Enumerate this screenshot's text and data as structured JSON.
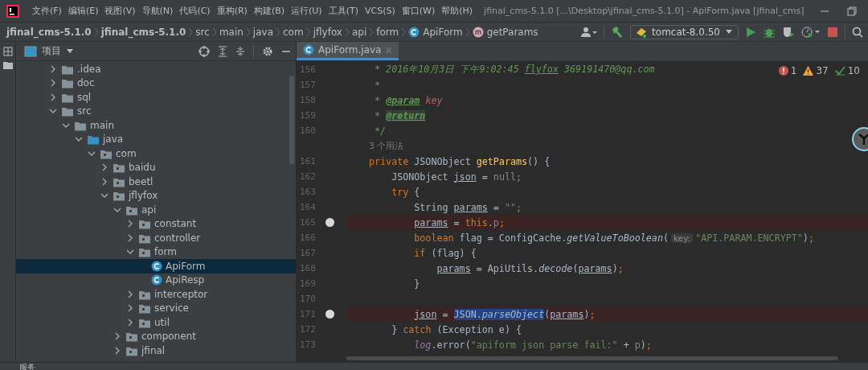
{
  "title_bar": {
    "menus": [
      "文件(F)",
      "编辑(E)",
      "视图(V)",
      "导航(N)",
      "代码(C)",
      "重构(R)",
      "构建(B)",
      "运行(U)",
      "工具(T)",
      "VCS(S)",
      "窗口(W)",
      "帮助(H)"
    ],
    "title": "jfinal_cms-5.1.0 [...\\Desktop\\jfinal_cms-5.1.0] - ApiForm.java [jfinal_cms]"
  },
  "breadcrumbs": [
    {
      "label": "jfinal_cms-5.1.0",
      "kind": "module"
    },
    {
      "label": "jfinal_cms-5.1.0",
      "kind": "module"
    },
    {
      "label": "src",
      "kind": "folder"
    },
    {
      "label": "main",
      "kind": "folder"
    },
    {
      "label": "java",
      "kind": "folder"
    },
    {
      "label": "com",
      "kind": "folder"
    },
    {
      "label": "jflyfox",
      "kind": "folder"
    },
    {
      "label": "api",
      "kind": "folder"
    },
    {
      "label": "form",
      "kind": "folder"
    },
    {
      "label": "ApiForm",
      "kind": "class"
    },
    {
      "label": "getParams",
      "kind": "method"
    }
  ],
  "toolbar": {
    "run_config": "tomcat-8.0.50"
  },
  "project_panel": {
    "title": "项目",
    "tree": [
      {
        "label": ".idea",
        "kind": "folder",
        "expanded": false,
        "selected": false
      },
      {
        "label": "doc",
        "kind": "folder",
        "expanded": false,
        "selected": false
      },
      {
        "label": "sql",
        "kind": "folder",
        "expanded": false,
        "selected": false
      },
      {
        "label": "src",
        "kind": "folder",
        "expanded": true,
        "selected": false,
        "children": [
          {
            "label": "main",
            "kind": "folder",
            "expanded": true,
            "selected": false,
            "children": [
              {
                "label": "java",
                "kind": "source",
                "expanded": true,
                "selected": false,
                "children": [
                  {
                    "label": "com",
                    "kind": "package",
                    "expanded": true,
                    "selected": false,
                    "children": [
                      {
                        "label": "baidu",
                        "kind": "package",
                        "expanded": false,
                        "selected": false
                      },
                      {
                        "label": "beetl",
                        "kind": "package",
                        "expanded": false,
                        "selected": false
                      },
                      {
                        "label": "jflyfox",
                        "kind": "package",
                        "expanded": true,
                        "selected": false,
                        "children": [
                          {
                            "label": "api",
                            "kind": "package",
                            "expanded": true,
                            "selected": false,
                            "children": [
                              {
                                "label": "constant",
                                "kind": "package",
                                "expanded": false,
                                "selected": false
                              },
                              {
                                "label": "controller",
                                "kind": "package",
                                "expanded": false,
                                "selected": false
                              },
                              {
                                "label": "form",
                                "kind": "package",
                                "expanded": true,
                                "selected": false,
                                "children": [
                                  {
                                    "label": "ApiForm",
                                    "kind": "class",
                                    "selected": true
                                  },
                                  {
                                    "label": "ApiResp",
                                    "kind": "class",
                                    "selected": false
                                  }
                                ]
                              },
                              {
                                "label": "interceptor",
                                "kind": "package",
                                "expanded": false,
                                "selected": false
                              },
                              {
                                "label": "service",
                                "kind": "package",
                                "expanded": false,
                                "selected": false
                              },
                              {
                                "label": "util",
                                "kind": "package",
                                "expanded": false,
                                "selected": false
                              }
                            ]
                          },
                          {
                            "label": "component",
                            "kind": "package",
                            "expanded": false,
                            "selected": false
                          },
                          {
                            "label": "jfinal",
                            "kind": "package",
                            "expanded": false,
                            "selected": false
                          }
                        ]
                      }
                    ]
                  }
                ]
              }
            ]
          }
        ]
      }
    ]
  },
  "editor": {
    "tabs": [
      {
        "label": "ApiForm.java",
        "selected": true
      }
    ],
    "inspections": {
      "errors": "1",
      "warnings": "37",
      "weak_warnings": "10"
    },
    "lines": [
      {
        "number": "156",
        "breakpoint": false,
        "segments": [
          {
            "text": " * 2016年10月3日 下午9:02:45 ",
            "kind": "comment"
          },
          {
            "text": "flyfox",
            "kind": "link"
          },
          {
            "text": " 369191470@qq.com",
            "kind": "comment"
          }
        ]
      },
      {
        "number": "157",
        "breakpoint": false,
        "segments": [
          {
            "text": " *",
            "kind": "comment"
          }
        ]
      },
      {
        "number": "158",
        "breakpoint": false,
        "segments": [
          {
            "text": " * ",
            "kind": "comment"
          },
          {
            "text": "@param",
            "kind": "doctag"
          },
          {
            "text": " key",
            "kind": "docparam"
          }
        ]
      },
      {
        "number": "159",
        "breakpoint": false,
        "segments": [
          {
            "text": " * ",
            "kind": "comment"
          },
          {
            "text": "@return",
            "kind": "doctagmark"
          }
        ]
      },
      {
        "number": "160",
        "breakpoint": false,
        "segments": [
          {
            "text": " */",
            "kind": "comment"
          }
        ]
      },
      {
        "kind": "usages",
        "text": "3 个用法"
      },
      {
        "number": "161",
        "breakpoint": false,
        "segments": [
          {
            "text": "private ",
            "kind": "keyword"
          },
          {
            "text": "JSONObject ",
            "kind": "plain"
          },
          {
            "text": "getParams",
            "kind": "method"
          },
          {
            "text": "() {",
            "kind": "plain"
          }
        ]
      },
      {
        "number": "162",
        "breakpoint": false,
        "segments": [
          {
            "text": "    JSONObject ",
            "kind": "plain"
          },
          {
            "text": "json",
            "kind": "var"
          },
          {
            "text": " = ",
            "kind": "plain"
          },
          {
            "text": "null",
            "kind": "null"
          },
          {
            "text": ";",
            "kind": "punct"
          }
        ]
      },
      {
        "number": "163",
        "breakpoint": false,
        "segments": [
          {
            "text": "    try ",
            "kind": "keyword"
          },
          {
            "text": "{",
            "kind": "plain"
          }
        ]
      },
      {
        "number": "164",
        "breakpoint": false,
        "segments": [
          {
            "text": "        String ",
            "kind": "plain"
          },
          {
            "text": "params",
            "kind": "var"
          },
          {
            "text": " = ",
            "kind": "plain"
          },
          {
            "text": "\"\"",
            "kind": "string"
          },
          {
            "text": ";",
            "kind": "punct"
          }
        ]
      },
      {
        "number": "165",
        "breakpoint": true,
        "segments": [
          {
            "text": "        params",
            "kind": "var"
          },
          {
            "text": " = ",
            "kind": "plain"
          },
          {
            "text": "this",
            "kind": "keyword"
          },
          {
            "text": ".",
            "kind": "plain"
          },
          {
            "text": "p",
            "kind": "field"
          },
          {
            "text": ";",
            "kind": "punct"
          }
        ]
      },
      {
        "number": "166",
        "breakpoint": false,
        "segments": [
          {
            "text": "        boolean ",
            "kind": "keyword"
          },
          {
            "text": "flag = ConfigCache.",
            "kind": "plain"
          },
          {
            "text": "getValueToBoolean",
            "kind": "static"
          },
          {
            "text": "(",
            "kind": "plain"
          },
          {
            "text": "key:",
            "kind": "hint"
          },
          {
            "text": "\"API.PARAM.ENCRYPT\"",
            "kind": "string"
          },
          {
            "text": ")",
            "kind": "plain"
          },
          {
            "text": ";",
            "kind": "punct"
          }
        ]
      },
      {
        "number": "167",
        "breakpoint": false,
        "segments": [
          {
            "text": "        if ",
            "kind": "keyword"
          },
          {
            "text": "(flag) {",
            "kind": "plain"
          }
        ]
      },
      {
        "number": "168",
        "breakpoint": false,
        "segments": [
          {
            "text": "            params",
            "kind": "var"
          },
          {
            "text": " = ApiUtils.",
            "kind": "plain"
          },
          {
            "text": "decode",
            "kind": "static"
          },
          {
            "text": "(",
            "kind": "plain"
          },
          {
            "text": "params",
            "kind": "var"
          },
          {
            "text": ")",
            "kind": "plain"
          },
          {
            "text": ";",
            "kind": "punct"
          }
        ]
      },
      {
        "number": "169",
        "breakpoint": false,
        "segments": [
          {
            "text": "        }",
            "kind": "plain"
          }
        ]
      },
      {
        "number": "170",
        "breakpoint": false
      },
      {
        "number": "171",
        "breakpoint": true,
        "segments": [
          {
            "text": "        json",
            "kind": "var"
          },
          {
            "text": " = ",
            "kind": "plain"
          },
          {
            "text": "JSON.",
            "kind": "sel"
          },
          {
            "text": "parseObject",
            "kind": "selcall"
          },
          {
            "text": "(",
            "kind": "plain"
          },
          {
            "text": "params",
            "kind": "var"
          },
          {
            "text": ")",
            "kind": "plain"
          },
          {
            "text": ";",
            "kind": "punct"
          }
        ]
      },
      {
        "number": "172",
        "breakpoint": false,
        "segments": [
          {
            "text": "    } ",
            "kind": "plain"
          },
          {
            "text": "catch ",
            "kind": "keyword"
          },
          {
            "text": "(Exception e) {",
            "kind": "plain"
          }
        ]
      },
      {
        "number": "173",
        "breakpoint": false,
        "segments": [
          {
            "text": "        log",
            "kind": "staticfield"
          },
          {
            "text": ".error(",
            "kind": "plain"
          },
          {
            "text": "\"apiform json parse fail:\"",
            "kind": "string"
          },
          {
            "text": " + ",
            "kind": "plain"
          },
          {
            "text": "p",
            "kind": "field"
          },
          {
            "text": ")",
            "kind": "plain"
          },
          {
            "text": ";",
            "kind": "punct"
          }
        ]
      }
    ]
  },
  "bottom_bar": {
    "label": "服务"
  }
}
